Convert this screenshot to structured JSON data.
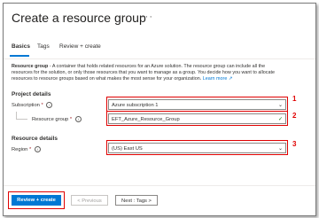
{
  "page": {
    "title": "Create a resource group",
    "more_menu": "···"
  },
  "tabs": [
    {
      "label": "Basics"
    },
    {
      "label": "Tags"
    },
    {
      "label": "Review + create"
    }
  ],
  "description": {
    "term": "Resource group",
    "text": " - A container that holds related resources for an Azure solution. The resource group can include all the resources for the solution, or only those resources that you want to manage as a group. You decide how you want to allocate resources to resource groups based on what makes the most sense for your organization. ",
    "link": "Learn more"
  },
  "project_details": {
    "heading": "Project details",
    "subscription_label": "Subscription",
    "subscription_value": "Azure subscription 1",
    "resource_group_label": "Resource group",
    "resource_group_value": "EFT_Azure_Resource_Group"
  },
  "resource_details": {
    "heading": "Resource details",
    "region_label": "Region",
    "region_value": "(US) East US"
  },
  "annotations": [
    "1",
    "2",
    "3"
  ],
  "required_mark": "*",
  "footer": {
    "review_create": "Review + create",
    "previous": "< Previous",
    "next": "Next : Tags >"
  },
  "colors": {
    "accent": "#0078d4",
    "annotation_red": "#e00000"
  }
}
